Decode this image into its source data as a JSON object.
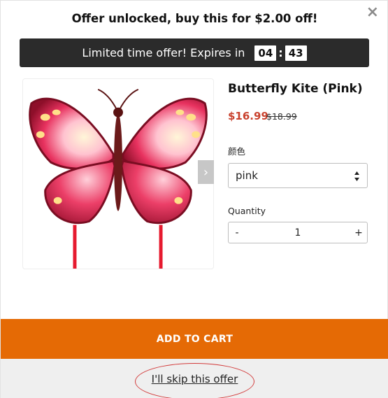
{
  "modal": {
    "close_symbol": "×",
    "offer_title": "Offer unlocked, buy this for $2.00 off!"
  },
  "timer": {
    "label": "Limited time offer! Expires in",
    "minutes": "04",
    "separator": ":",
    "seconds": "43"
  },
  "product": {
    "title": "Butterfly Kite (Pink)",
    "price": "$16.99",
    "compare_price": "$18.99",
    "image_icon": "butterfly-kite-image",
    "next_image_symbol": "›"
  },
  "options": {
    "color_label": "颜色",
    "color_value": "pink"
  },
  "quantity": {
    "label": "Quantity",
    "minus": "-",
    "value": "1",
    "plus": "+"
  },
  "actions": {
    "add_to_cart": "ADD TO CART",
    "skip": "I'll skip this offer"
  },
  "colors": {
    "accent": "#e56a05",
    "price": "#c9422e",
    "timer_bg": "#2b2b2b",
    "skip_ring": "#d23b3b"
  }
}
